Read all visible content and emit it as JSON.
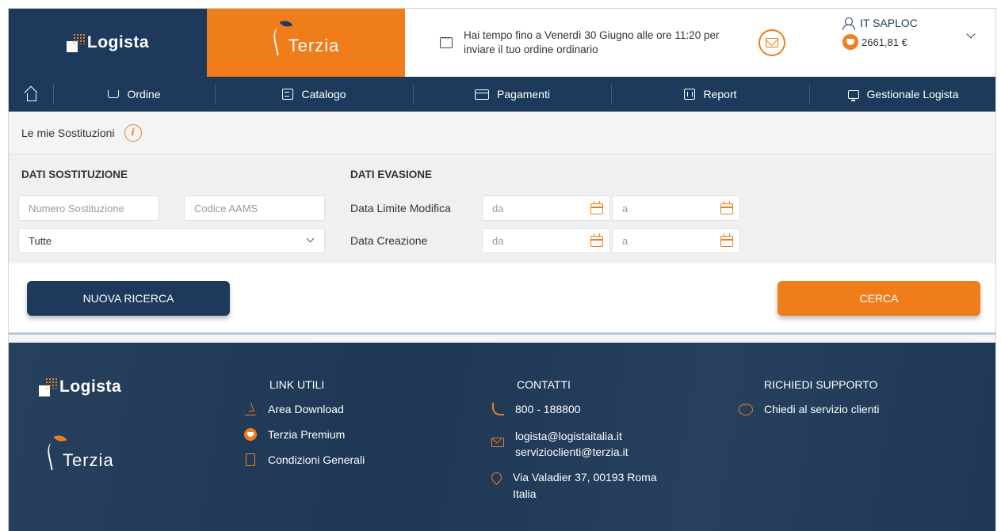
{
  "header": {
    "logista_logo": "Logista",
    "terzia_logo": "Terzia",
    "notice": "Hai tempo fino a Venerdì 30 Giugno alle ore 11:20 per inviare il tuo ordine ordinario",
    "user_name": "IT SAPLOC",
    "balance": "2661,81 €"
  },
  "nav": {
    "items": [
      {
        "label": "Ordine",
        "icon": "cart-icon"
      },
      {
        "label": "Catalogo",
        "icon": "catalog-icon"
      },
      {
        "label": "Pagamenti",
        "icon": "card-icon"
      },
      {
        "label": "Report",
        "icon": "report-icon"
      },
      {
        "label": "Gestionale Logista",
        "icon": "monitor-icon"
      }
    ]
  },
  "breadcrumb": {
    "label": "Le mie Sostituzioni"
  },
  "filters": {
    "section_left": "DATI SOSTITUZIONE",
    "section_right": "DATI EVASIONE",
    "numero_placeholder": "Numero Sostituzione",
    "codice_placeholder": "Codice AAMS",
    "status_value": "Tutte",
    "data_limite_label": "Data Limite Modifica",
    "data_creazione_label": "Data Creazione",
    "from_placeholder": "da",
    "to_placeholder": "a"
  },
  "actions": {
    "new_search": "NUOVA RICERCA",
    "search": "CERCA"
  },
  "footer": {
    "logista_logo": "Logista",
    "terzia_logo": "Terzia",
    "links_title": "LINK UTILI",
    "links": [
      "Area Download",
      "Terzia Premium",
      "Condizioni Generali"
    ],
    "contacts_title": "CONTATTI",
    "phone": "800 - 188800",
    "email1": "logista@logistaitalia.it",
    "email2": "servizioclienti@terzia.it",
    "address1": "Via Valadier 37, 00193 Roma",
    "address2": "Italia",
    "support_title": "RICHIEDI SUPPORTO",
    "support_link": "Chiedi al servizio clienti"
  },
  "colors": {
    "navy": "#1d3a5c",
    "orange": "#f07d1b"
  }
}
